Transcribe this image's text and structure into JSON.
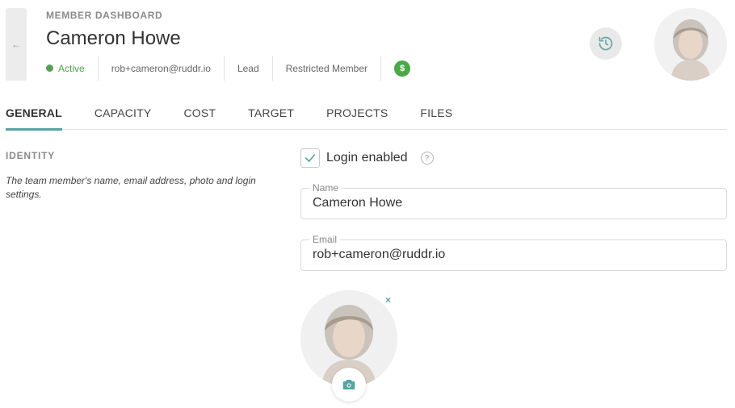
{
  "header": {
    "back_icon": "arrow-left-icon",
    "eyebrow": "MEMBER DASHBOARD",
    "name": "Cameron Howe",
    "status": "Active",
    "email": "rob+cameron@ruddr.io",
    "job_title": "Lead",
    "security_role": "Restricted Member",
    "money_badge": "$",
    "history_icon": "history-icon",
    "avatar_icon": "avatar-photo-icon"
  },
  "tabs": [
    {
      "label": "GENERAL",
      "active": true
    },
    {
      "label": "CAPACITY",
      "active": false
    },
    {
      "label": "COST",
      "active": false
    },
    {
      "label": "TARGET",
      "active": false
    },
    {
      "label": "PROJECTS",
      "active": false
    },
    {
      "label": "FILES",
      "active": false
    }
  ],
  "identity": {
    "title": "IDENTITY",
    "description": "The team member's name, email address, photo and login settings.",
    "login_enabled_label": "Login enabled",
    "login_enabled": true,
    "help_glyph": "?",
    "name_label": "Name",
    "name_value": "Cameron Howe",
    "email_label": "Email",
    "email_value": "rob+cameron@ruddr.io",
    "photo_remove": "×",
    "camera_icon": "camera-icon"
  },
  "colors": {
    "accent": "#55a5a0",
    "active_green": "#55a050",
    "badge_green": "#4aa846"
  }
}
